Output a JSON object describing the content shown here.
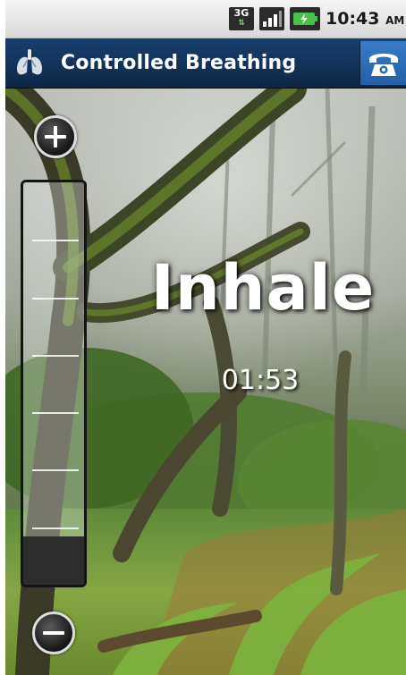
{
  "status_bar": {
    "network_label": "3G",
    "network_icon": "network-3g-icon",
    "signal_icon": "signal-bars-icon",
    "battery_icon": "battery-charging-icon",
    "time": "10:43",
    "ampm": "AM"
  },
  "title_bar": {
    "app_icon": "lungs-icon",
    "title": "Controlled Breathing",
    "action_icon": "phone-icon"
  },
  "controls": {
    "increase_icon": "plus-icon",
    "decrease_icon": "minus-icon"
  },
  "gauge": {
    "level": 0.12,
    "tick_count": 6
  },
  "breathing": {
    "phase": "Inhale",
    "timer": "01:53"
  },
  "colors": {
    "title_bar": "#17406f",
    "action_button": "#2f6fba",
    "gauge_fill": "#2d2d2d",
    "text": "#ffffff"
  }
}
